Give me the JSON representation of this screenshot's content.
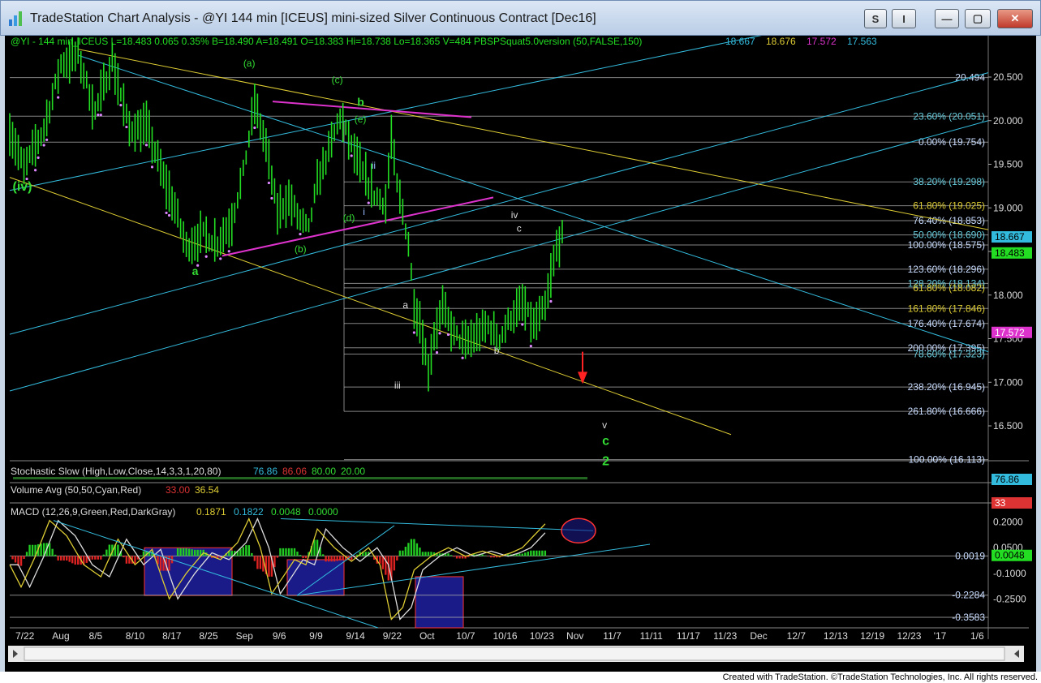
{
  "window": {
    "title": "TradeStation Chart Analysis - @YI 144 min [ICEUS] mini-sized Silver Continuous Contract [Dec16]",
    "btn_s": "S",
    "btn_i": "I",
    "btn_min": "—",
    "btn_max": "▢",
    "btn_close": "✕"
  },
  "footer": {
    "credit": "Created with TradeStation. ©TradeStation Technologies, Inc. All rights reserved."
  },
  "colors": {
    "price": "#22dd22",
    "cyan": "#33bbdd",
    "yellow": "#ddcc33",
    "magenta": "#dd33cc",
    "fib": "#c8c8c8",
    "green_label": "#33dd33"
  },
  "chart_data": {
    "type": "line",
    "header": "@YI - 144 min_ICEUS  L=18.483  0.065  0.35%  B=18.490  A=18.491  O=18.383  Hi=18.738  Lo=18.365  V=484  PBSPSquat5.0version (50,FALSE,150)",
    "header_values": [
      {
        "text": "18.667",
        "color": "#33bbdd"
      },
      {
        "text": "18.676",
        "color": "#ddcc33"
      },
      {
        "text": "17.572",
        "color": "#dd33cc"
      },
      {
        "text": "17.563",
        "color": "#33bbdd"
      }
    ],
    "ylim": [
      16.1,
      20.9
    ],
    "y_ticks": [
      "20.500",
      "20.000",
      "19.500",
      "19.000",
      "18.500",
      "18.000",
      "17.500",
      "17.000",
      "16.500"
    ],
    "x_ticks": [
      "7/22",
      "Aug",
      "8/5",
      "8/10",
      "8/17",
      "8/25",
      "Sep",
      "9/6",
      "9/9",
      "9/14",
      "9/22",
      "Oct",
      "10/7",
      "10/16",
      "10/23",
      "Nov",
      "11/7",
      "11/11",
      "11/17",
      "11/23",
      "Dec",
      "12/7",
      "12/13",
      "12/19",
      "12/23",
      "'17",
      "1/6"
    ],
    "bar_index_max": 200,
    "keypoints": [
      [
        0,
        19.9
      ],
      [
        5,
        19.45
      ],
      [
        12,
        19.9
      ],
      [
        18,
        20.65
      ],
      [
        24,
        20.75
      ],
      [
        30,
        20.1
      ],
      [
        36,
        20.7
      ],
      [
        42,
        19.9
      ],
      [
        48,
        19.95
      ],
      [
        54,
        19.35
      ],
      [
        58,
        19.0
      ],
      [
        62,
        18.55
      ],
      [
        68,
        18.7
      ],
      [
        73,
        18.6
      ],
      [
        78,
        18.85
      ],
      [
        82,
        19.4
      ],
      [
        86,
        20.2
      ],
      [
        90,
        19.7
      ],
      [
        94,
        18.95
      ],
      [
        98,
        19.1
      ],
      [
        102,
        18.85
      ],
      [
        105,
        18.75
      ],
      [
        108,
        19.3
      ],
      [
        112,
        19.65
      ],
      [
        116,
        20.05
      ],
      [
        120,
        19.7
      ],
      [
        124,
        19.4
      ],
      [
        128,
        19.15
      ],
      [
        132,
        19.05
      ],
      [
        134,
        19.8
      ],
      [
        136,
        19.25
      ],
      [
        138,
        18.95
      ],
      [
        140,
        18.6
      ],
      [
        142,
        17.9
      ],
      [
        144,
        17.7
      ],
      [
        147,
        17.15
      ],
      [
        149,
        17.55
      ],
      [
        152,
        17.85
      ],
      [
        156,
        17.55
      ],
      [
        160,
        17.45
      ],
      [
        164,
        17.55
      ],
      [
        168,
        17.65
      ],
      [
        172,
        17.5
      ],
      [
        176,
        17.75
      ],
      [
        180,
        17.9
      ],
      [
        184,
        17.65
      ],
      [
        188,
        17.85
      ],
      [
        190,
        18.2
      ],
      [
        192,
        18.55
      ],
      [
        194,
        18.67
      ]
    ],
    "fib_levels": [
      {
        "label": "20.494",
        "value": 20.494
      },
      {
        "label": "23.60% (20.051)",
        "value": 20.051
      },
      {
        "label": "0.00% (19.754)",
        "value": 19.754
      },
      {
        "label": "38.20% (19.298)",
        "value": 19.298
      },
      {
        "label": "61.80% (19.025)",
        "value": 19.025
      },
      {
        "label": "76.40% (18.853)",
        "value": 18.853
      },
      {
        "label": "50.00% (18.690)",
        "value": 18.69
      },
      {
        "label": "100.00% (18.575)",
        "value": 18.575
      },
      {
        "label": "123.60% (18.296)",
        "value": 18.296
      },
      {
        "label": "128.20% (18.134)",
        "value": 18.134
      },
      {
        "label": "61.80% (18.082)",
        "value": 18.082
      },
      {
        "label": "161.80% (17.846)",
        "value": 17.846
      },
      {
        "label": "176.40% (17.674)",
        "value": 17.674
      },
      {
        "label": "200.00% (17.395)",
        "value": 17.395
      },
      {
        "label": "78.60% (17.323)",
        "value": 17.323
      },
      {
        "label": "238.20% (16.945)",
        "value": 16.945
      },
      {
        "label": "261.80% (16.666)",
        "value": 16.666
      },
      {
        "label": "100.00% (16.113)",
        "value": 16.113
      }
    ],
    "price_tags": [
      {
        "text": "18.667",
        "value": 18.667,
        "bg": "#33bbdd",
        "fg": "#000000"
      },
      {
        "text": "18.483",
        "value": 18.483,
        "bg": "#22dd22",
        "fg": "#000000"
      },
      {
        "text": "17.572",
        "value": 17.572,
        "bg": "#dd33cc",
        "fg": "#ffffff"
      }
    ],
    "wave_labels": [
      {
        "text": "(iv)",
        "x": 1,
        "y": 19.2,
        "color": "#33dd33",
        "size": 16,
        "bold": true
      },
      {
        "text": "a",
        "x": 64,
        "y": 18.23,
        "color": "#33dd33",
        "size": 14,
        "bold": true
      },
      {
        "text": "(a)",
        "x": 82,
        "y": 20.62,
        "color": "#33dd33",
        "size": 12,
        "bold": false
      },
      {
        "text": "(b)",
        "x": 100,
        "y": 18.49,
        "color": "#33dd33",
        "size": 12,
        "bold": false
      },
      {
        "text": "(c)",
        "x": 113,
        "y": 20.43,
        "color": "#33dd33",
        "size": 12,
        "bold": false
      },
      {
        "text": "b",
        "x": 122,
        "y": 20.17,
        "color": "#33dd33",
        "size": 14,
        "bold": true
      },
      {
        "text": "(e)",
        "x": 121,
        "y": 19.98,
        "color": "#33dd33",
        "size": 12,
        "bold": false
      },
      {
        "text": "(d)",
        "x": 117,
        "y": 18.85,
        "color": "#33dd33",
        "size": 12,
        "bold": false
      },
      {
        "text": "ii",
        "x": 127,
        "y": 19.45,
        "color": "#99bbff",
        "size": 12,
        "bold": false
      },
      {
        "text": "i",
        "x": 124,
        "y": 18.92,
        "color": "#99bbff",
        "size": 12,
        "bold": false
      },
      {
        "text": "a",
        "x": 138,
        "y": 17.85,
        "color": "#dddddd",
        "size": 12,
        "bold": false
      },
      {
        "text": "iii",
        "x": 135,
        "y": 16.93,
        "color": "#dddddd",
        "size": 12,
        "bold": false
      },
      {
        "text": "b",
        "x": 170,
        "y": 17.33,
        "color": "#dddddd",
        "size": 12,
        "bold": false
      },
      {
        "text": "iv",
        "x": 176,
        "y": 18.88,
        "color": "#dddddd",
        "size": 12,
        "bold": false
      },
      {
        "text": "c",
        "x": 178,
        "y": 18.73,
        "color": "#dddddd",
        "size": 12,
        "bold": false
      },
      {
        "text": "v",
        "x": 208,
        "y": 16.47,
        "color": "#dddddd",
        "size": 12,
        "bold": false
      },
      {
        "text": "c",
        "x": 208,
        "y": 16.28,
        "color": "#33dd33",
        "size": 16,
        "bold": true
      },
      {
        "text": "2",
        "x": 208,
        "y": 16.05,
        "color": "#33dd33",
        "size": 16,
        "bold": true
      }
    ],
    "stochastic": {
      "label": "Stochastic Slow (High,Low,Close,14,3,3,1,20,80)",
      "values": [
        {
          "text": "76.86",
          "color": "#33bbdd"
        },
        {
          "text": "86.06",
          "color": "#dd3333"
        },
        {
          "text": "80.00",
          "color": "#33dd33"
        },
        {
          "text": "20.00",
          "color": "#33dd33"
        }
      ],
      "tag": "76.86"
    },
    "volume": {
      "label": "Volume Avg (50,50,Cyan,Red)",
      "values": [
        {
          "text": "33.00",
          "color": "#dd3333"
        },
        {
          "text": "36.54",
          "color": "#ddcc33"
        }
      ],
      "tag": "33"
    },
    "macd": {
      "label": "MACD (12,26,9,Green,Red,DarkGray)",
      "values": [
        {
          "text": "0.1871",
          "color": "#ddcc33"
        },
        {
          "text": "0.1822",
          "color": "#33bbdd"
        },
        {
          "text": "0.0048",
          "color": "#33dd33"
        },
        {
          "text": "0.0000",
          "color": "#33dd33"
        }
      ],
      "ylim": [
        -0.42,
        0.27
      ],
      "ticks": [
        {
          "label": "0.2000",
          "value": 0.2
        },
        {
          "label": "0.0500",
          "value": 0.05
        },
        {
          "label": "-0.1000",
          "value": -0.1
        },
        {
          "label": "-0.2500",
          "value": -0.25
        }
      ],
      "levels": [
        {
          "label": "0.0019",
          "value": 0.0019
        },
        {
          "label": "-0.2284",
          "value": -0.2284
        },
        {
          "label": "-0.3583",
          "value": -0.3583
        }
      ],
      "tag": "0.0048",
      "keypoints": [
        [
          0,
          -0.05
        ],
        [
          4,
          -0.18
        ],
        [
          9,
          0.0
        ],
        [
          14,
          0.21
        ],
        [
          20,
          0.12
        ],
        [
          26,
          -0.05
        ],
        [
          32,
          -0.12
        ],
        [
          38,
          0.1
        ],
        [
          44,
          -0.05
        ],
        [
          50,
          0.04
        ],
        [
          56,
          -0.25
        ],
        [
          62,
          -0.1
        ],
        [
          68,
          0.02
        ],
        [
          74,
          -0.02
        ],
        [
          80,
          0.08
        ],
        [
          84,
          0.22
        ],
        [
          88,
          0.05
        ],
        [
          92,
          -0.22
        ],
        [
          96,
          -0.12
        ],
        [
          100,
          -0.02
        ],
        [
          104,
          -0.05
        ],
        [
          108,
          0.16
        ],
        [
          114,
          0.05
        ],
        [
          120,
          -0.03
        ],
        [
          126,
          0.05
        ],
        [
          130,
          -0.05
        ],
        [
          134,
          -0.37
        ],
        [
          138,
          -0.3
        ],
        [
          142,
          -0.08
        ],
        [
          148,
          0.0
        ],
        [
          154,
          0.05
        ],
        [
          160,
          0.0
        ],
        [
          166,
          0.03
        ],
        [
          172,
          0.0
        ],
        [
          176,
          0.02
        ],
        [
          180,
          0.05
        ],
        [
          184,
          0.12
        ],
        [
          188,
          0.19
        ]
      ]
    }
  }
}
